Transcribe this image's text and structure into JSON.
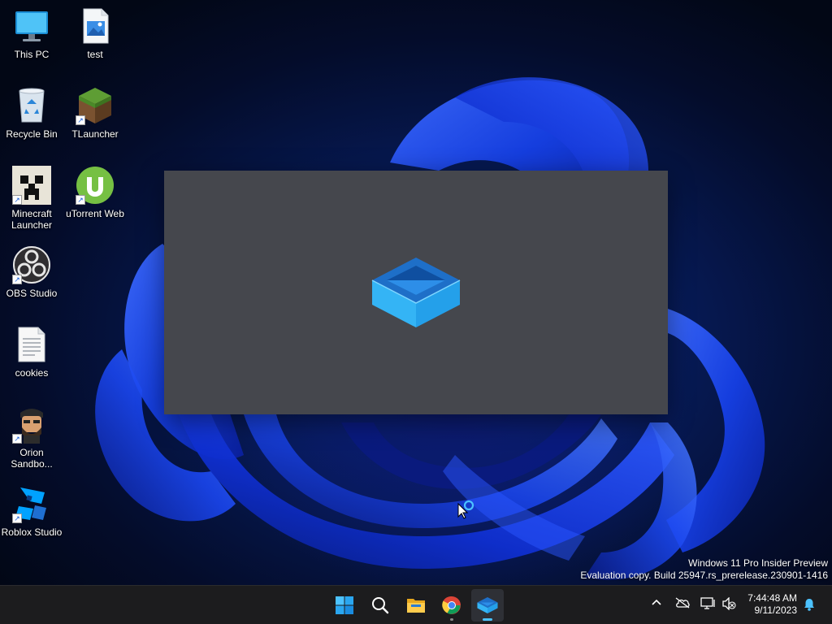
{
  "desktop": {
    "icons": [
      {
        "label": "This PC",
        "icon": "computer-icon",
        "shortcut": false
      },
      {
        "label": "test",
        "icon": "image-file-icon",
        "shortcut": false
      },
      {
        "label": "Recycle Bin",
        "icon": "recycle-bin-icon",
        "shortcut": false
      },
      {
        "label": "TLauncher",
        "icon": "grass-block-icon",
        "shortcut": true
      },
      {
        "label": "Minecraft Launcher",
        "icon": "creeper-icon",
        "shortcut": true
      },
      {
        "label": "uTorrent Web",
        "icon": "utorrent-icon",
        "shortcut": true
      },
      {
        "label": "OBS Studio",
        "icon": "obs-icon",
        "shortcut": true
      },
      {
        "label": "cookies",
        "icon": "text-file-icon",
        "shortcut": false
      },
      {
        "label": "Orion Sandbo...",
        "icon": "orion-avatar-icon",
        "shortcut": true
      },
      {
        "label": "Roblox Studio",
        "icon": "roblox-studio-icon",
        "shortcut": true
      }
    ]
  },
  "splash": {
    "icon": "sandbox-box-icon",
    "background_color": "#45474d"
  },
  "watermark": {
    "line1": "Windows 11 Pro Insider Preview",
    "line2": "Evaluation copy. Build 25947.rs_prerelease.230901-1416"
  },
  "taskbar": {
    "apps": [
      {
        "name": "Start",
        "icon": "windows-logo-icon"
      },
      {
        "name": "Search",
        "icon": "search-icon"
      },
      {
        "name": "File Explorer",
        "icon": "folder-icon"
      },
      {
        "name": "Google Chrome",
        "icon": "chrome-icon",
        "running": true
      },
      {
        "name": "Windows Sandbox",
        "icon": "sandbox-box-icon",
        "active": true
      }
    ],
    "tray": {
      "icons": [
        "chevron-up-icon",
        "cloud-off-icon",
        "network-icon",
        "volume-muted-icon"
      ],
      "time": "7:44:48 AM",
      "date": "9/11/2023",
      "notification_icon": "bell-icon"
    },
    "accent_color": "#4cc2ff"
  }
}
